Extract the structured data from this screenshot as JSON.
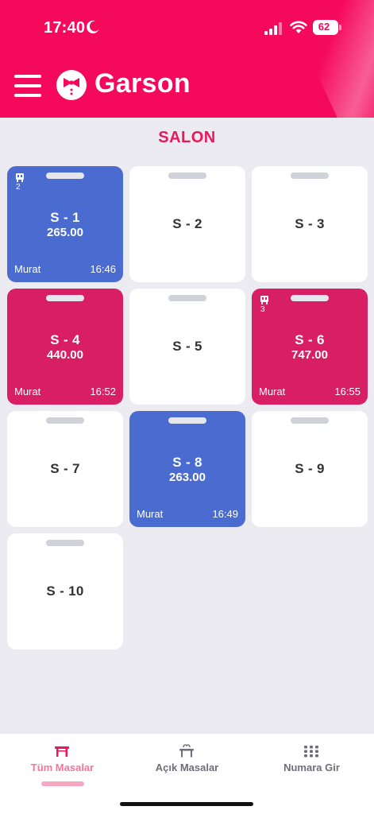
{
  "status_bar": {
    "time": "17:40",
    "battery": "62"
  },
  "header": {
    "title": "Garson",
    "menu_icon": "hamburger-icon",
    "logo_icon": "bowtie-waiter-icon"
  },
  "section": {
    "title": "SALON"
  },
  "tables": [
    {
      "name": "S - 1",
      "status": "open",
      "amount": "265.00",
      "waiter": "Murat",
      "time": "16:46",
      "guests": "2",
      "color": "#4a6bd0"
    },
    {
      "name": "S - 2",
      "status": "empty"
    },
    {
      "name": "S - 3",
      "status": "empty"
    },
    {
      "name": "S - 4",
      "status": "open",
      "amount": "440.00",
      "waiter": "Murat",
      "time": "16:52",
      "color": "#d91f63"
    },
    {
      "name": "S - 5",
      "status": "empty"
    },
    {
      "name": "S - 6",
      "status": "open",
      "amount": "747.00",
      "waiter": "Murat",
      "time": "16:55",
      "guests": "3",
      "color": "#d91f63"
    },
    {
      "name": "S - 7",
      "status": "empty"
    },
    {
      "name": "S - 8",
      "status": "open",
      "amount": "263.00",
      "waiter": "Murat",
      "time": "16:49",
      "color": "#4a6bd0"
    },
    {
      "name": "S - 9",
      "status": "empty"
    },
    {
      "name": "S - 10",
      "status": "empty"
    }
  ],
  "tabs": [
    {
      "label": "Tüm Masalar",
      "icon": "table-icon",
      "active": true
    },
    {
      "label": "Açık Masalar",
      "icon": "dining-table-icon",
      "active": false
    },
    {
      "label": "Numara Gir",
      "icon": "keypad-icon",
      "active": false
    }
  ],
  "colors": {
    "brand": "#f5095a",
    "open_blue": "#4a6bd0",
    "open_red": "#d91f63",
    "active_tab": "#f2789b"
  }
}
